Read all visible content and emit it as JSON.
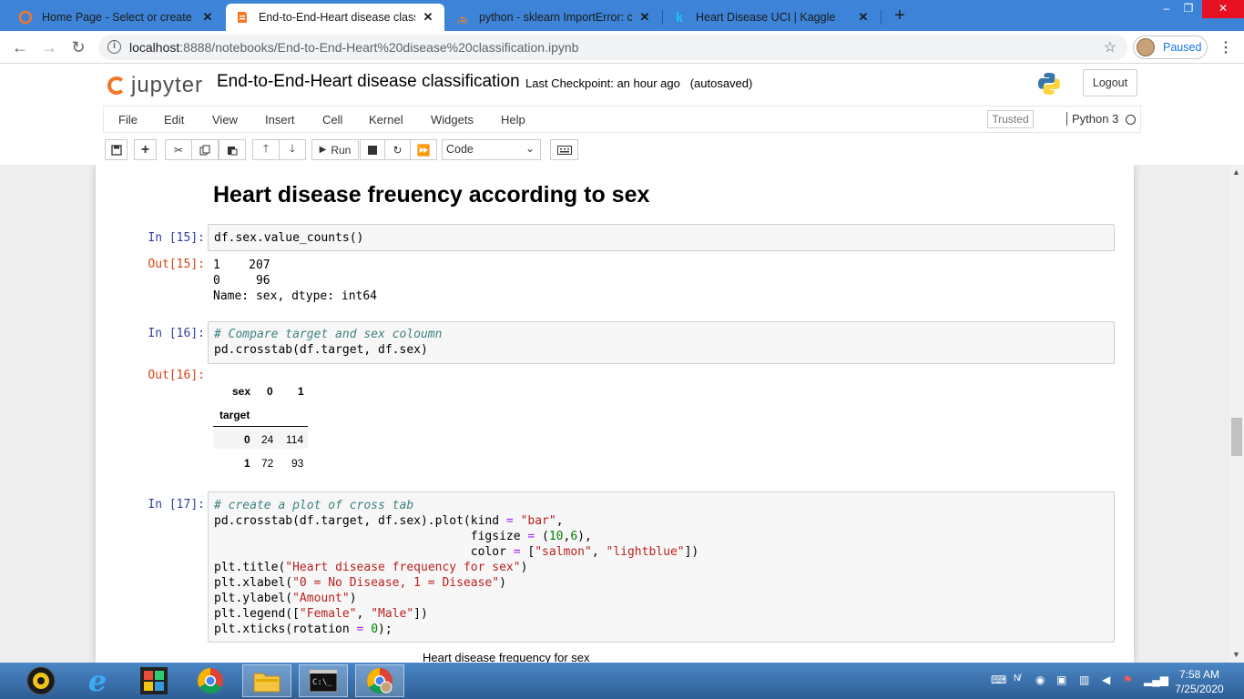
{
  "browser": {
    "tabs": [
      {
        "title": "Home Page - Select or create a n",
        "active": false,
        "favicon": "jupyter-icon"
      },
      {
        "title": "End-to-End-Heart disease classifi",
        "active": true,
        "favicon": "jupyter-notebook-icon"
      },
      {
        "title": "python - sklearn ImportError: can",
        "active": false,
        "favicon": "stackoverflow-icon"
      },
      {
        "title": "Heart Disease UCI | Kaggle",
        "active": false,
        "favicon": "kaggle-icon"
      }
    ],
    "url_host": "localhost",
    "url_rest": ":8888/notebooks/End-to-End-Heart%20disease%20classification.ipynb",
    "profile_label": "Paused"
  },
  "jupyter": {
    "logo_text": "jupyter",
    "notebook_name": "End-to-End-Heart disease classification",
    "checkpoint": "Last Checkpoint: an hour ago",
    "autosave": "(autosaved)",
    "logout_label": "Logout",
    "menu": [
      "File",
      "Edit",
      "View",
      "Insert",
      "Cell",
      "Kernel",
      "Widgets",
      "Help"
    ],
    "trusted_label": "Trusted",
    "kernel_name": "Python 3",
    "run_label": "Run",
    "cell_type": "Code"
  },
  "notebook": {
    "heading": "Heart disease freuency according to sex",
    "cell15": {
      "in_prompt": "In [15]:",
      "code": "df.sex.value_counts()",
      "out_prompt": "Out[15]:",
      "output_lines": [
        "1    207",
        "0     96",
        "Name: sex, dtype: int64"
      ]
    },
    "cell16": {
      "in_prompt": "In [16]:",
      "comment": "# Compare target and sex coloumn",
      "code_line2": "pd.crosstab(df.target, df.sex)",
      "out_prompt": "Out[16]:",
      "table": {
        "columns_name": "sex",
        "col_headers": [
          "0",
          "1"
        ],
        "index_name": "target",
        "rows": [
          {
            "index": "0",
            "values": [
              "24",
              "114"
            ]
          },
          {
            "index": "1",
            "values": [
              "72",
              "93"
            ]
          }
        ]
      }
    },
    "cell17": {
      "in_prompt": "In [17]:",
      "comment": "# create a plot of cross tab",
      "plot_title_preview": "Heart disease frequency for sex"
    }
  },
  "taskbar": {
    "time": "7:58 AM",
    "date": "7/25/2020"
  }
}
